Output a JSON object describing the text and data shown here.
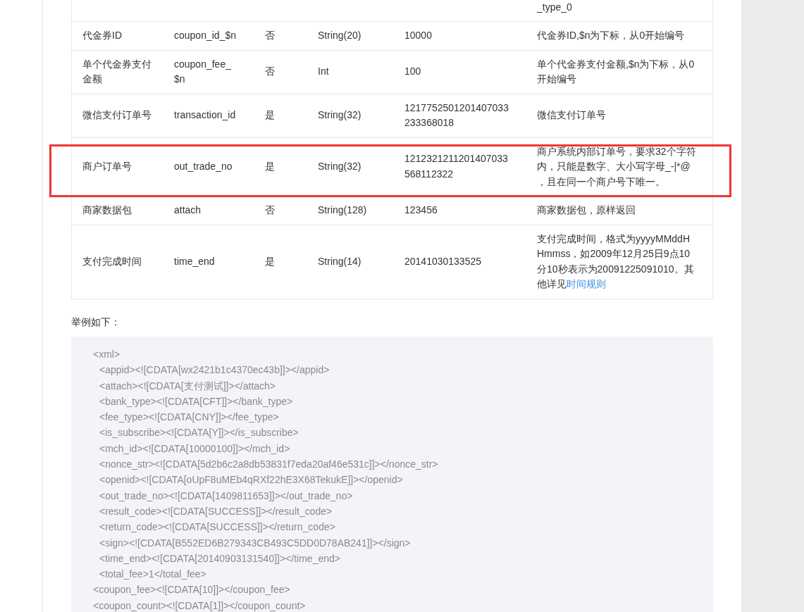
{
  "table": {
    "rows": [
      {
        "highlighted": false,
        "column_6": "_type_0"
      },
      {
        "highlighted": false,
        "column_1": "代金券ID",
        "column_2": "coupon_id_$n",
        "column_3": "否",
        "column_4": "String(20)",
        "column_5": "10000",
        "column_6": "代金券ID,$n为下标，从0开始编号"
      },
      {
        "highlighted": false,
        "column_1": "单个代金券支付金额",
        "column_2": "coupon_fee_$n",
        "column_3": "否",
        "column_4": "Int",
        "column_5": "100",
        "column_6": "单个代金券支付金额,$n为下标，从0开始编号"
      },
      {
        "highlighted": false,
        "column_1": "微信支付订单号",
        "column_2": "transaction_id",
        "column_3": "是",
        "column_4": "String(32)",
        "column_5": "1217752501201407033233368018",
        "column_6": "微信支付订单号"
      },
      {
        "highlighted": true,
        "column_1": "商户订单号",
        "column_2": "out_trade_no",
        "column_3": "是",
        "column_4": "String(32)",
        "column_5": "1212321211201407033568112322",
        "column_6": "商户系统内部订单号，要求32个字符内，只能是数字、大小写字母_-|*@ ，且在同一个商户号下唯一。"
      },
      {
        "highlighted": false,
        "column_1": "商家数据包",
        "column_2": "attach",
        "column_3": "否",
        "column_4": "String(128)",
        "column_5": "123456",
        "column_6": "商家数据包，原样返回"
      },
      {
        "highlighted": false,
        "column_1": "支付完成时间",
        "column_2": "time_end",
        "column_3": "是",
        "column_4": "String(14)",
        "column_5": "20141030133525",
        "column_6": "支付完成时间，格式为yyyyMMddHHmmss，如2009年12月25日9点10分10秒表示为20091225091010。其他详见",
        "column_6_link": "时间规则"
      }
    ]
  },
  "example_label": "举例如下：",
  "code_block": {
    "lines": [
      {
        "text": "<xml>",
        "children": [
          {
            "text": "<appid><![CDATA[wx2421b1c4370ec43b]]></appid>"
          },
          {
            "text": "<attach><![CDATA[支付测试]]></attach>"
          },
          {
            "text": "<bank_type><![CDATA[CFT]]></bank_type>"
          },
          {
            "text": "<fee_type><![CDATA[CNY]]></fee_type>"
          },
          {
            "text": "<is_subscribe><![CDATA[Y]]></is_subscribe>"
          },
          {
            "text": "<mch_id><![CDATA[10000100]]></mch_id>"
          },
          {
            "text": "<nonce_str><![CDATA[5d2b6c2a8db53831f7eda20af46e531c]]></nonce_str>"
          },
          {
            "text": "<openid><![CDATA[oUpF8uMEb4qRXf22hE3X68TekukE]]></openid>"
          },
          {
            "text": "<out_trade_no><![CDATA[1409811653]]></out_trade_no>"
          },
          {
            "text": "<result_code><![CDATA[SUCCESS]]></result_code>"
          },
          {
            "text": "<return_code><![CDATA[SUCCESS]]></return_code>"
          },
          {
            "text": "<sign><![CDATA[B552ED6B279343CB493C5DD0D78AB241]]></sign>"
          },
          {
            "text": "<time_end><![CDATA[20140903131540]]></time_end>"
          },
          {
            "text": "<total_fee>1</total_fee>"
          }
        ]
      },
      {
        "text": "<coupon_fee><![CDATA[10]]></coupon_fee>"
      },
      {
        "text": "<coupon_count><![CDATA[1]]></coupon_count>"
      }
    ]
  }
}
